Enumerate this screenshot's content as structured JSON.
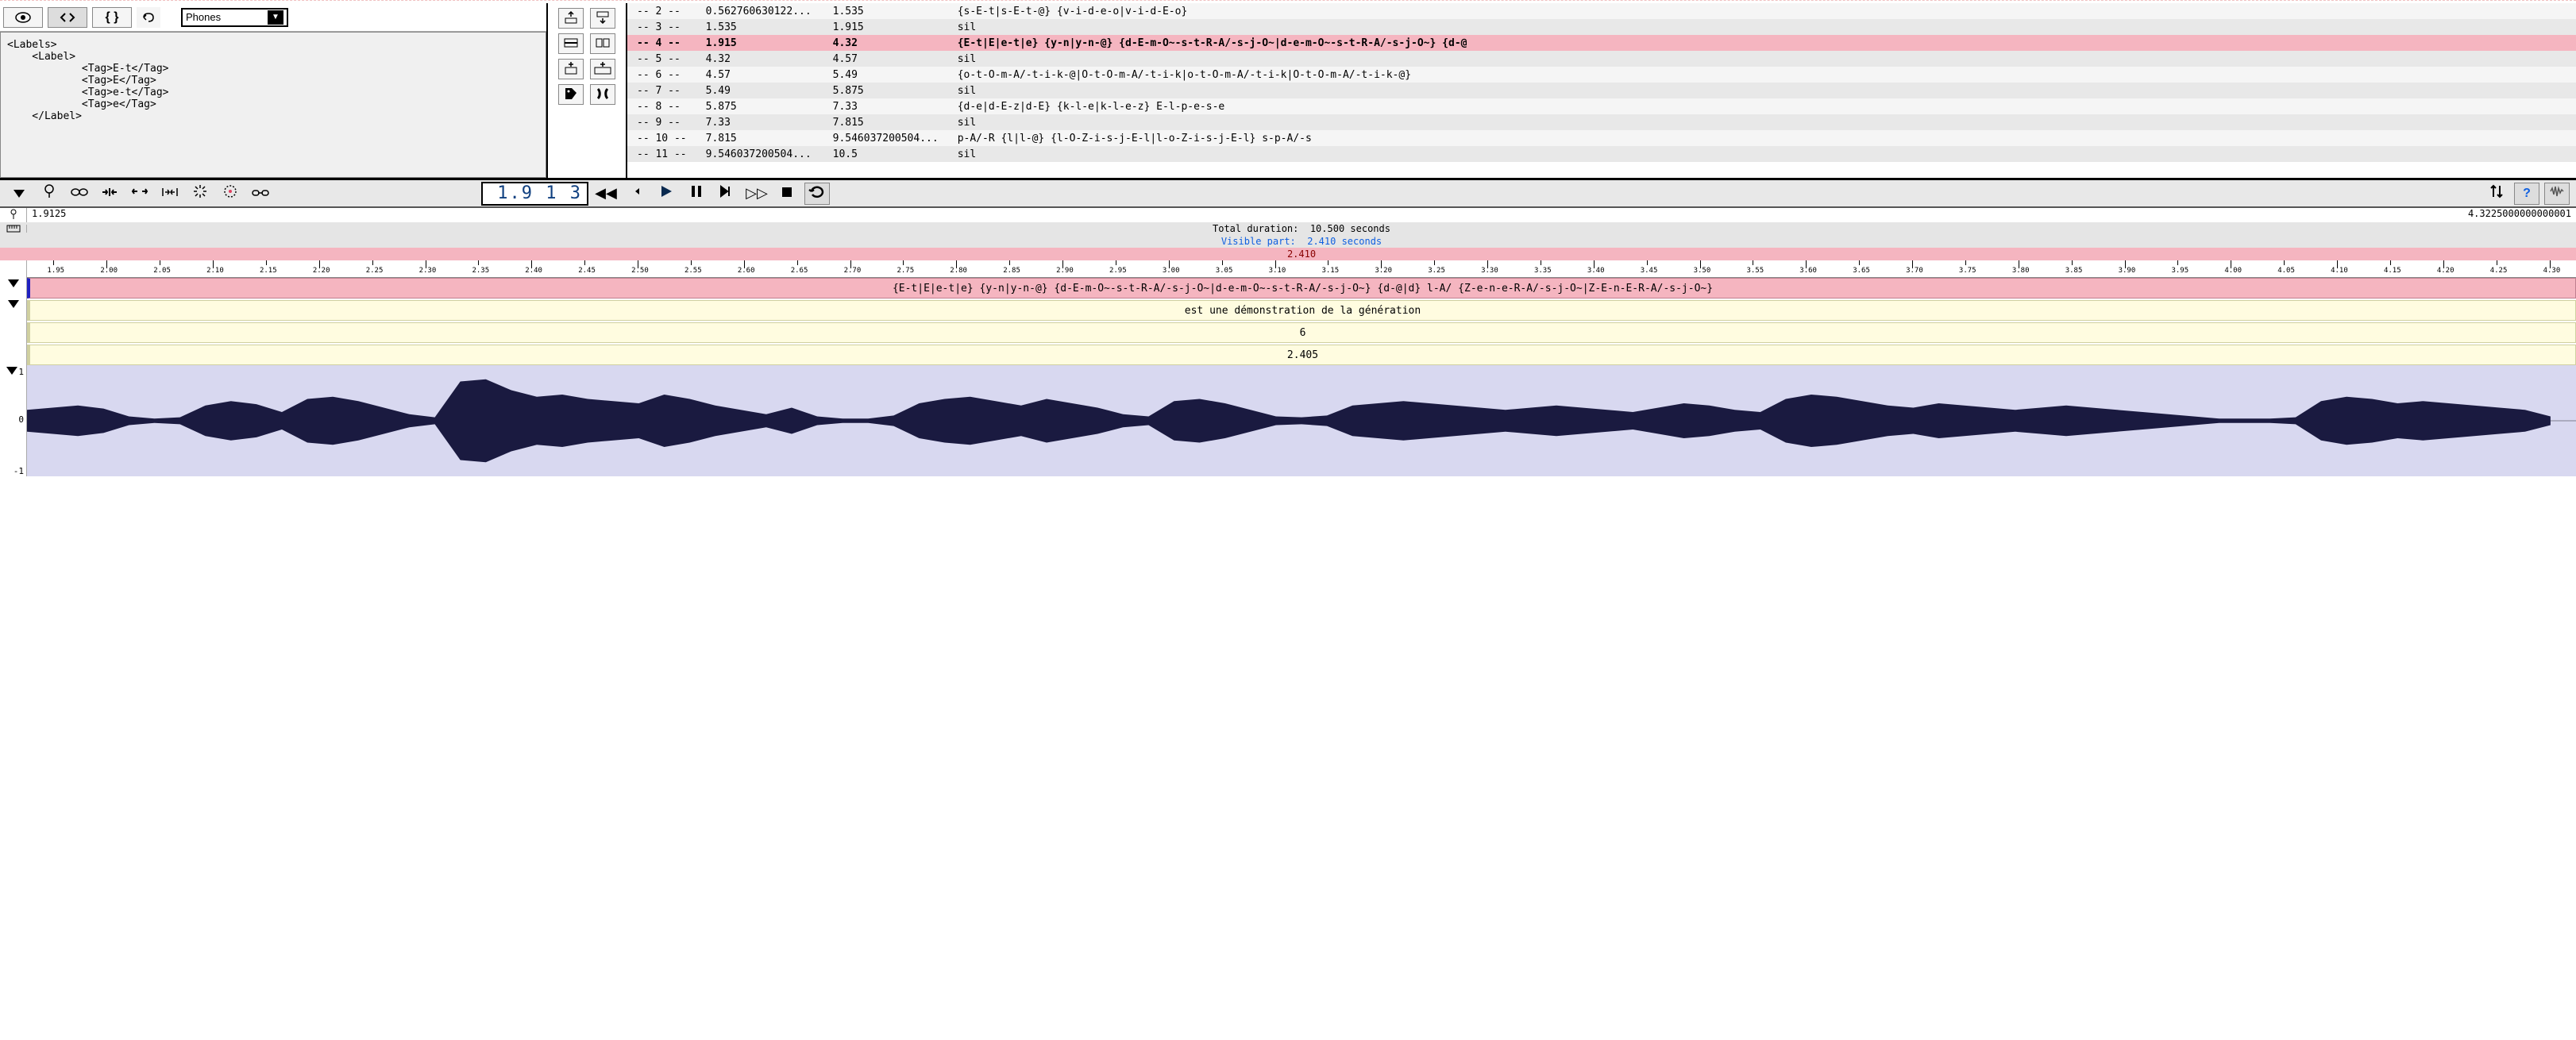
{
  "dropdown": {
    "label": "Phones"
  },
  "xml": {
    "l1": "<Labels>",
    "l2": "    <Label>",
    "l3": "            <Tag>E-t</Tag>",
    "l4": "            <Tag>E</Tag>",
    "l5": "            <Tag>e-t</Tag>",
    "l6": "            <Tag>e</Tag>",
    "l7": "    </Label>"
  },
  "table": [
    {
      "id": "-- 2 --",
      "begin": "0.562760630122...",
      "end": "1.535",
      "label": "{s-E-t|s-E-t-@} {v-i-d-e-o|v-i-d-E-o}"
    },
    {
      "id": "-- 3 --",
      "begin": "1.535",
      "end": "1.915",
      "label": "sil"
    },
    {
      "id": "-- 4 --",
      "begin": "1.915",
      "end": "4.32",
      "label": "{E-t|E|e-t|e} {y-n|y-n-@} {d-E-m-O~-s-t-R-A/-s-j-O~|d-e-m-O~-s-t-R-A/-s-j-O~} {d-@",
      "selected": true
    },
    {
      "id": "-- 5 --",
      "begin": "4.32",
      "end": "4.57",
      "label": "sil"
    },
    {
      "id": "-- 6 --",
      "begin": "4.57",
      "end": "5.49",
      "label": "{o-t-O-m-A/-t-i-k-@|O-t-O-m-A/-t-i-k|o-t-O-m-A/-t-i-k|O-t-O-m-A/-t-i-k-@}"
    },
    {
      "id": "-- 7 --",
      "begin": "5.49",
      "end": "5.875",
      "label": "sil"
    },
    {
      "id": "-- 8 --",
      "begin": "5.875",
      "end": "7.33",
      "label": "{d-e|d-E-z|d-E} {k-l-e|k-l-e-z} E-l-p-e-s-e"
    },
    {
      "id": "-- 9 --",
      "begin": "7.33",
      "end": "7.815",
      "label": "sil"
    },
    {
      "id": "-- 10 --",
      "begin": "7.815",
      "end": "9.546037200504...",
      "label": "p-A/-R {l|l-@} {l-O-Z-i-s-j-E-l|l-o-Z-i-s-j-E-l} s-p-A/-s"
    },
    {
      "id": "-- 11 --",
      "begin": "9.546037200504...",
      "end": "10.5",
      "label": "sil"
    }
  ],
  "time_display": "1.9 1 3",
  "start_time": "1.9125",
  "end_time": "4.3225000000000001",
  "total_duration_label": "Total duration:",
  "total_duration_value": "10.500 seconds",
  "visible_label": "Visible part:",
  "visible_value": "2.410 seconds",
  "visible_short": "2.410",
  "ruler_ticks": [
    "1.95",
    "2.00",
    "2.05",
    "2.10",
    "2.15",
    "2.20",
    "2.25",
    "2.30",
    "2.35",
    "2.40",
    "2.45",
    "2.50",
    "2.55",
    "2.60",
    "2.65",
    "2.70",
    "2.75",
    "2.80",
    "2.85",
    "2.90",
    "2.95",
    "3.00",
    "3.05",
    "3.10",
    "3.15",
    "3.20",
    "3.25",
    "3.30",
    "3.35",
    "3.40",
    "3.45",
    "3.50",
    "3.55",
    "3.60",
    "3.65",
    "3.70",
    "3.75",
    "3.80",
    "3.85",
    "3.90",
    "3.95",
    "4.00",
    "4.05",
    "4.10",
    "4.15",
    "4.20",
    "4.25",
    "4.30"
  ],
  "tier1_text": "{E-t|E|e-t|e} {y-n|y-n-@} {d-E-m-O~-s-t-R-A/-s-j-O~|d-e-m-O~-s-t-R-A/-s-j-O~} {d-@|d} l-A/ {Z-e-n-e-R-A/-s-j-O~|Z-E-n-E-R-A/-s-j-O~}",
  "tier2_text": "est une démonstration de la génération",
  "tier3_text": "6",
  "tier4_text": "2.405",
  "wave_y_top": "1",
  "wave_y_mid": "0",
  "wave_y_bot": "-1"
}
